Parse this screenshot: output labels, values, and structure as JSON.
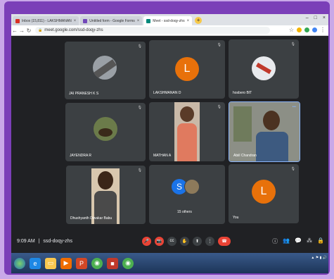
{
  "browser": {
    "tabs": [
      {
        "label": "Inbox (15,811) - LAKSHMANAN",
        "color": "#d93025",
        "active": false
      },
      {
        "label": "Untitled form - Google Forms",
        "color": "#7248b9",
        "active": false
      },
      {
        "label": "Meet - ssd-doqy-zhs",
        "color": "#00897b",
        "active": true
      }
    ],
    "new_tab": "+",
    "url": "meet.google.com/ssd-doqy-zhs"
  },
  "participants": [
    {
      "name": "JAI PRANESH K S"
    },
    {
      "name": "LAKSHMANAN D",
      "initial": "L"
    },
    {
      "name": "hosbero BIT"
    },
    {
      "name": "JAYENDRA R"
    },
    {
      "name": "MATHAN A"
    },
    {
      "name": "Abiil Chandran"
    },
    {
      "name": "Dhushyanth Diwakar Babu"
    },
    {
      "name": "15 others",
      "initial": "S"
    },
    {
      "name": "You",
      "initial": "L"
    }
  ],
  "meeting": {
    "time": "9:09 AM",
    "separator": "|",
    "code": "ssd-doqy-zhs"
  },
  "colors": {
    "meet_bg": "#202124",
    "tile_bg": "#3c4043",
    "avatar_orange": "#e8710a",
    "end_call_red": "#ea4335",
    "frame_purple": "#7b3fb8"
  }
}
